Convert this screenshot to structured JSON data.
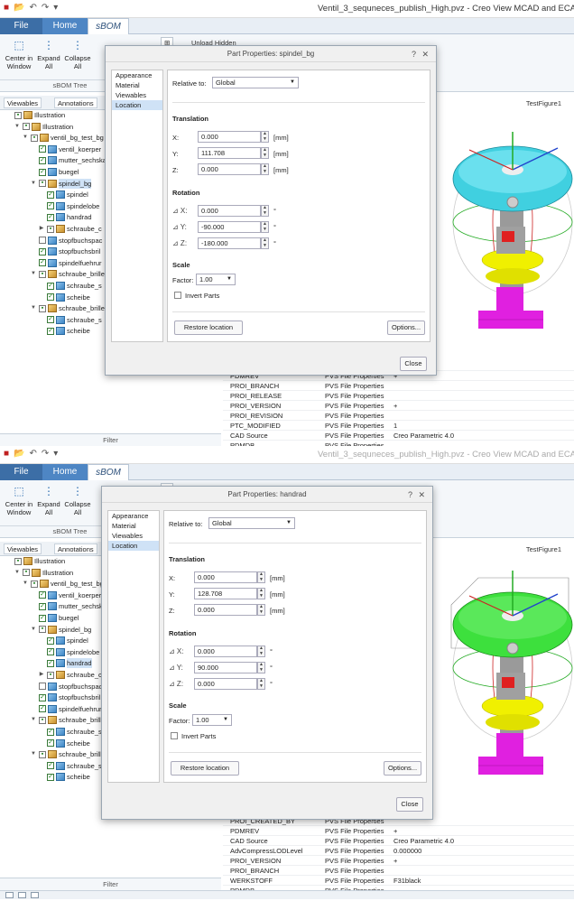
{
  "app": {
    "window_title": "Ventil_3_sequneces_publish_High.pvz - Creo View MCAD and ECAD",
    "tabs": [
      "File",
      "Home",
      "sBOM"
    ],
    "ribbon": {
      "center_in_window": "Center in Window",
      "expand": "Expand All",
      "collapse": "Collapse All",
      "group_label": "sBOM Tree",
      "unload_hidden": "Unload Hidden"
    },
    "panel_tabs": [
      "Viewables",
      "Annotations"
    ],
    "filter_label": "Filter",
    "viewer_label": "TestFigure1"
  },
  "frame1": {
    "tree": [
      {
        "label": "Illustration",
        "level": 0,
        "kind": "asm",
        "twist": "",
        "check": "box"
      },
      {
        "label": "Illustration",
        "level": 1,
        "kind": "asm",
        "twist": "▼",
        "check": "box"
      },
      {
        "label": "ventil_bg_test_bg",
        "level": 2,
        "kind": "asm",
        "twist": "▼",
        "check": "box"
      },
      {
        "label": "ventil_koerper",
        "level": 3,
        "kind": "part",
        "twist": "",
        "check": "on"
      },
      {
        "label": "mutter_sechska",
        "level": 3,
        "kind": "part",
        "twist": "",
        "check": "on"
      },
      {
        "label": "buegel",
        "level": 3,
        "kind": "part",
        "twist": "",
        "check": "on"
      },
      {
        "label": "spindel_bg",
        "level": 3,
        "kind": "asm",
        "twist": "▼",
        "check": "box",
        "selected": true
      },
      {
        "label": "spindel",
        "level": 4,
        "kind": "part",
        "twist": "",
        "check": "on"
      },
      {
        "label": "spindelobe",
        "level": 4,
        "kind": "part",
        "twist": "",
        "check": "on"
      },
      {
        "label": "handrad",
        "level": 4,
        "kind": "part",
        "twist": "",
        "check": "on"
      },
      {
        "label": "schraube_c",
        "level": 4,
        "kind": "asm",
        "twist": "▶",
        "check": "box"
      },
      {
        "label": "stopfbuchspac",
        "level": 3,
        "kind": "part",
        "twist": "",
        "check": "off"
      },
      {
        "label": "stopfbuchsbril",
        "level": 3,
        "kind": "part",
        "twist": "",
        "check": "on"
      },
      {
        "label": "spindelfuehrur",
        "level": 3,
        "kind": "part",
        "twist": "",
        "check": "on"
      },
      {
        "label": "schraube_brille",
        "level": 3,
        "kind": "asm",
        "twist": "▼",
        "check": "box"
      },
      {
        "label": "schraube_s",
        "level": 4,
        "kind": "part",
        "twist": "",
        "check": "on"
      },
      {
        "label": "scheibe",
        "level": 4,
        "kind": "part",
        "twist": "",
        "check": "on"
      },
      {
        "label": "schraube_brille",
        "level": 3,
        "kind": "asm",
        "twist": "▼",
        "check": "box"
      },
      {
        "label": "schraube_s",
        "level": 4,
        "kind": "part",
        "twist": "",
        "check": "on"
      },
      {
        "label": "scheibe",
        "level": 4,
        "kind": "part",
        "twist": "",
        "check": "on"
      }
    ],
    "dialog": {
      "title": "Part Properties: spindel_bg",
      "nav": [
        "Appearance",
        "Material",
        "Viewables",
        "Location"
      ],
      "relative_to_label": "Relative to:",
      "relative_to_value": "Global",
      "translation_label": "Translation",
      "x_label": "X:",
      "x": "0.000",
      "y_label": "Y:",
      "y": "111.708",
      "z_label": "Z:",
      "z": "0.000",
      "unit": "[mm]",
      "rotation_label": "Rotation",
      "rx": "0.000",
      "ry": "-90.000",
      "rz": "-180.000",
      "deg": "°",
      "scale_label": "Scale",
      "factor_label": "Factor:",
      "factor": "1.00",
      "invert_parts": "Invert Parts",
      "restore_location": "Restore location",
      "options": "Options...",
      "close": "Close"
    },
    "props": [
      {
        "k": "",
        "s": "",
        "v": "48 PM"
      },
      {
        "k": "PDMREV",
        "s": "PVS File Properties",
        "v": "+"
      },
      {
        "k": "PROI_BRANCH",
        "s": "PVS File Properties",
        "v": ""
      },
      {
        "k": "PROI_RELEASE",
        "s": "PVS File Properties",
        "v": ""
      },
      {
        "k": "PROI_VERSION",
        "s": "PVS File Properties",
        "v": "+"
      },
      {
        "k": "PROI_REVISION",
        "s": "PVS File Properties",
        "v": ""
      },
      {
        "k": "PTC_MODIFIED",
        "s": "PVS File Properties",
        "v": "1"
      },
      {
        "k": "CAD Source",
        "s": "PVS File Properties",
        "v": "Creo Parametric 4.0"
      },
      {
        "k": "PDMDB",
        "s": "PVS File Properties",
        "v": ""
      }
    ]
  },
  "frame2": {
    "tree": [
      {
        "label": "Illustration",
        "level": 0,
        "kind": "asm",
        "twist": "",
        "check": "box"
      },
      {
        "label": "Illustration",
        "level": 1,
        "kind": "asm",
        "twist": "▼",
        "check": "box"
      },
      {
        "label": "ventil_bg_test_bg",
        "level": 2,
        "kind": "asm",
        "twist": "▼",
        "check": "box"
      },
      {
        "label": "ventil_koerper",
        "level": 3,
        "kind": "part",
        "twist": "",
        "check": "on"
      },
      {
        "label": "mutter_sechska",
        "level": 3,
        "kind": "part",
        "twist": "",
        "check": "on"
      },
      {
        "label": "buegel",
        "level": 3,
        "kind": "part",
        "twist": "",
        "check": "on"
      },
      {
        "label": "spindel_bg",
        "level": 3,
        "kind": "asm",
        "twist": "▼",
        "check": "box"
      },
      {
        "label": "spindel",
        "level": 4,
        "kind": "part",
        "twist": "",
        "check": "on"
      },
      {
        "label": "spindelobe",
        "level": 4,
        "kind": "part",
        "twist": "",
        "check": "on"
      },
      {
        "label": "handrad",
        "level": 4,
        "kind": "part",
        "twist": "",
        "check": "on",
        "selected": true
      },
      {
        "label": "schraube_c",
        "level": 4,
        "kind": "asm",
        "twist": "▶",
        "check": "box"
      },
      {
        "label": "stopfbuchspac",
        "level": 3,
        "kind": "part",
        "twist": "",
        "check": "off"
      },
      {
        "label": "stopfbuchsbril",
        "level": 3,
        "kind": "part",
        "twist": "",
        "check": "on"
      },
      {
        "label": "spindelfuehrur",
        "level": 3,
        "kind": "part",
        "twist": "",
        "check": "on"
      },
      {
        "label": "schraube_brille",
        "level": 3,
        "kind": "asm",
        "twist": "▼",
        "check": "box"
      },
      {
        "label": "schraube_s",
        "level": 4,
        "kind": "part",
        "twist": "",
        "check": "on"
      },
      {
        "label": "scheibe",
        "level": 4,
        "kind": "part",
        "twist": "",
        "check": "on"
      },
      {
        "label": "schraube_brille",
        "level": 3,
        "kind": "asm",
        "twist": "▼",
        "check": "box"
      },
      {
        "label": "schraube_s",
        "level": 4,
        "kind": "part",
        "twist": "",
        "check": "on"
      },
      {
        "label": "scheibe",
        "level": 4,
        "kind": "part",
        "twist": "",
        "check": "on"
      }
    ],
    "dialog": {
      "title": "Part Properties: handrad",
      "nav": [
        "Appearance",
        "Material",
        "Viewables",
        "Location"
      ],
      "relative_to_label": "Relative to:",
      "relative_to_value": "Global",
      "translation_label": "Translation",
      "x_label": "X:",
      "x": "0.000",
      "y_label": "Y:",
      "y": "128.708",
      "z_label": "Z:",
      "z": "0.000",
      "unit": "[mm]",
      "rotation_label": "Rotation",
      "rx": "0.000",
      "ry": "90.000",
      "rz": "0.000",
      "deg": "°",
      "scale_label": "Scale",
      "factor_label": "Factor:",
      "factor": "1.00",
      "invert_parts": "Invert Parts",
      "restore_location": "Restore location",
      "options": "Options...",
      "close": "Close"
    },
    "props": [
      {
        "k": "PROI_CREATED_BY",
        "s": "PVS File Properties",
        "v": ""
      },
      {
        "k": "PDMREV",
        "s": "PVS File Properties",
        "v": "+"
      },
      {
        "k": "CAD Source",
        "s": "PVS File Properties",
        "v": "Creo Parametric 4.0"
      },
      {
        "k": "AdvCompressLODLevel",
        "s": "PVS File Properties",
        "v": "0.000000"
      },
      {
        "k": "PROI_VERSION",
        "s": "PVS File Properties",
        "v": "+"
      },
      {
        "k": "PROI_BRANCH",
        "s": "PVS File Properties",
        "v": ""
      },
      {
        "k": "WERKSTOFF",
        "s": "PVS File Properties",
        "v": "F31black"
      },
      {
        "k": "PDMDB",
        "s": "PVS File Properties",
        "v": ""
      }
    ]
  },
  "colors": {
    "handwheel_f1": "#40d0e0",
    "handwheel_f2": "#3de03d",
    "part_yellow": "#f0f000",
    "part_magenta": "#e020e0",
    "part_red": "#e02020",
    "part_grey": "#9a9a9a"
  }
}
